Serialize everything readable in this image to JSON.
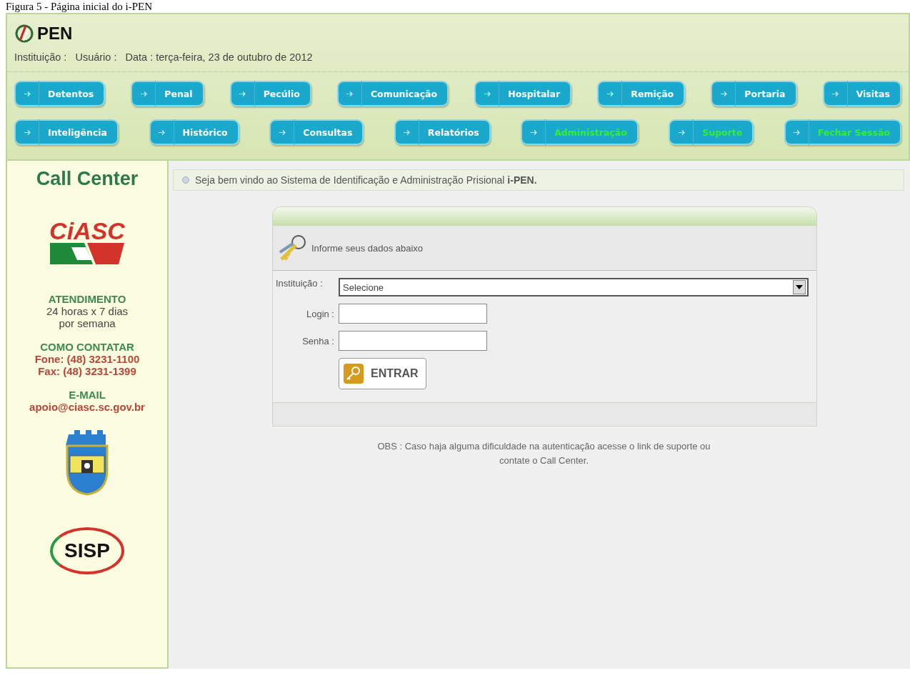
{
  "caption": "Figura 5 - Página inicial do i-PEN",
  "header": {
    "logo_text": "PEN",
    "info": "Instituição :   Usuário :   Data : terça-feira, 23 de outubro de 2012"
  },
  "menu": [
    [
      {
        "label": "Detentos",
        "color": "#ffffff"
      },
      {
        "label": "Penal",
        "color": "#ffffff"
      },
      {
        "label": "Pecúlio",
        "color": "#ffffff"
      },
      {
        "label": "Comunicação",
        "color": "#ffffff"
      },
      {
        "label": "Hospitalar",
        "color": "#ffffff"
      },
      {
        "label": "Remição",
        "color": "#ffffff"
      },
      {
        "label": "Portaria",
        "color": "#ffffff"
      },
      {
        "label": "Visitas",
        "color": "#ffffff"
      }
    ],
    [
      {
        "label": "Inteligência",
        "color": "#ffffff"
      },
      {
        "label": "Histórico",
        "color": "#ffffff"
      },
      {
        "label": "Consultas",
        "color": "#ffffff"
      },
      {
        "label": "Relatórios",
        "color": "#ffffff"
      },
      {
        "label": "Administração",
        "color": "#33ee33"
      },
      {
        "label": "Suporte",
        "color": "#33ee33"
      },
      {
        "label": "Fechar Sessão",
        "color": "#33ee33"
      }
    ]
  ],
  "sidebar": {
    "title": "Call Center",
    "logo_text": "CiASC",
    "attendance_heading": "ATENDIMENTO",
    "attendance": "24 horas x 7 dias por semana",
    "contact_heading": "COMO CONTATAR",
    "phone": "Fone: (48) 3231-1100",
    "fax": "Fax: (48) 3231-1399",
    "email_heading": "E-MAIL",
    "email": "apoio@ciasc.sc.gov.br",
    "bottom_logo_text": "SISP"
  },
  "welcome": "Seja bem vindo ao Sistema de Identificação e Administração Prisional **i-PEN.**",
  "login": {
    "heading": "Informe seus dados abaixo",
    "institution_label": "Instituição :",
    "institution_value": "Selecione",
    "login_label": "Login :",
    "password_label": "Senha :",
    "submit": "ENTRAR"
  },
  "note": "OBS : Caso haja alguma dificuldade na autenticação acesse o link de suporte ou contate o Call Center."
}
